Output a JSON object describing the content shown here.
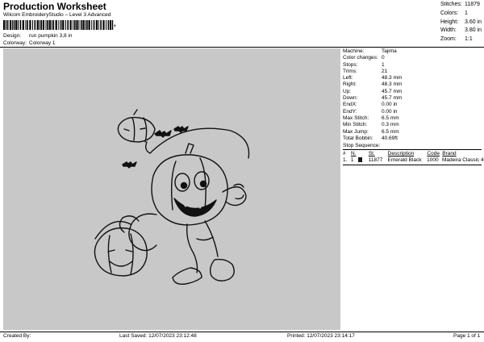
{
  "header": {
    "title": "Production Worksheet",
    "subtitle": "Wilcom EmbroideryStudio – Level 3 Advanced",
    "barcode_suffix": ","
  },
  "meta": {
    "design_label": "Design:",
    "design_value": "run pumpkin 3,8 in",
    "colorway_label": "Colorway:",
    "colorway_value": "Colorway 1"
  },
  "stats": [
    {
      "k": "Stitches:",
      "v": "11879"
    },
    {
      "k": "Colors:",
      "v": "1"
    },
    {
      "k": "Height:",
      "v": "3.60 in"
    },
    {
      "k": "Width:",
      "v": "3.80 in"
    },
    {
      "k": "Zoom:",
      "v": "1:1"
    }
  ],
  "machine": [
    {
      "k": "Machine:",
      "v": "Tajima"
    },
    {
      "k": "Color changes:",
      "v": "0"
    },
    {
      "k": "Stops:",
      "v": "1"
    },
    {
      "k": "Trims:",
      "v": "21"
    },
    {
      "k": "Left:",
      "v": "48.3 mm"
    },
    {
      "k": "Right:",
      "v": "48.3 mm"
    },
    {
      "k": "Up:",
      "v": "45.7 mm"
    },
    {
      "k": "Down:",
      "v": "45.7 mm"
    },
    {
      "k": "EndX:",
      "v": "0.00 in"
    },
    {
      "k": "EndY:",
      "v": "0.00 in"
    },
    {
      "k": "Max Stitch:",
      "v": "6.5 mm"
    },
    {
      "k": "Min Stitch:",
      "v": "0.3 mm"
    },
    {
      "k": "Max Jump:",
      "v": "6.5 mm"
    },
    {
      "k": "Total Bobbin:",
      "v": "40.69ft"
    }
  ],
  "stop_sequence": {
    "label": "Stop Sequence:",
    "headers": [
      "#",
      "N.",
      "St.",
      "Description",
      "Code",
      "Brand"
    ],
    "rows": [
      {
        "num": "1.",
        "n": "1",
        "st": "11877",
        "desc": "Emerald Black",
        "code": "1000",
        "brand": "Madeira Classic 40",
        "color": "#1a1a1a"
      }
    ]
  },
  "footer": {
    "created_by": "Created By:",
    "last_saved": "Last Saved: 12/07/2023 23:12:48",
    "printed": "Printed: 12/07/2023 23:14:17",
    "page": "Page 1 of 1"
  }
}
